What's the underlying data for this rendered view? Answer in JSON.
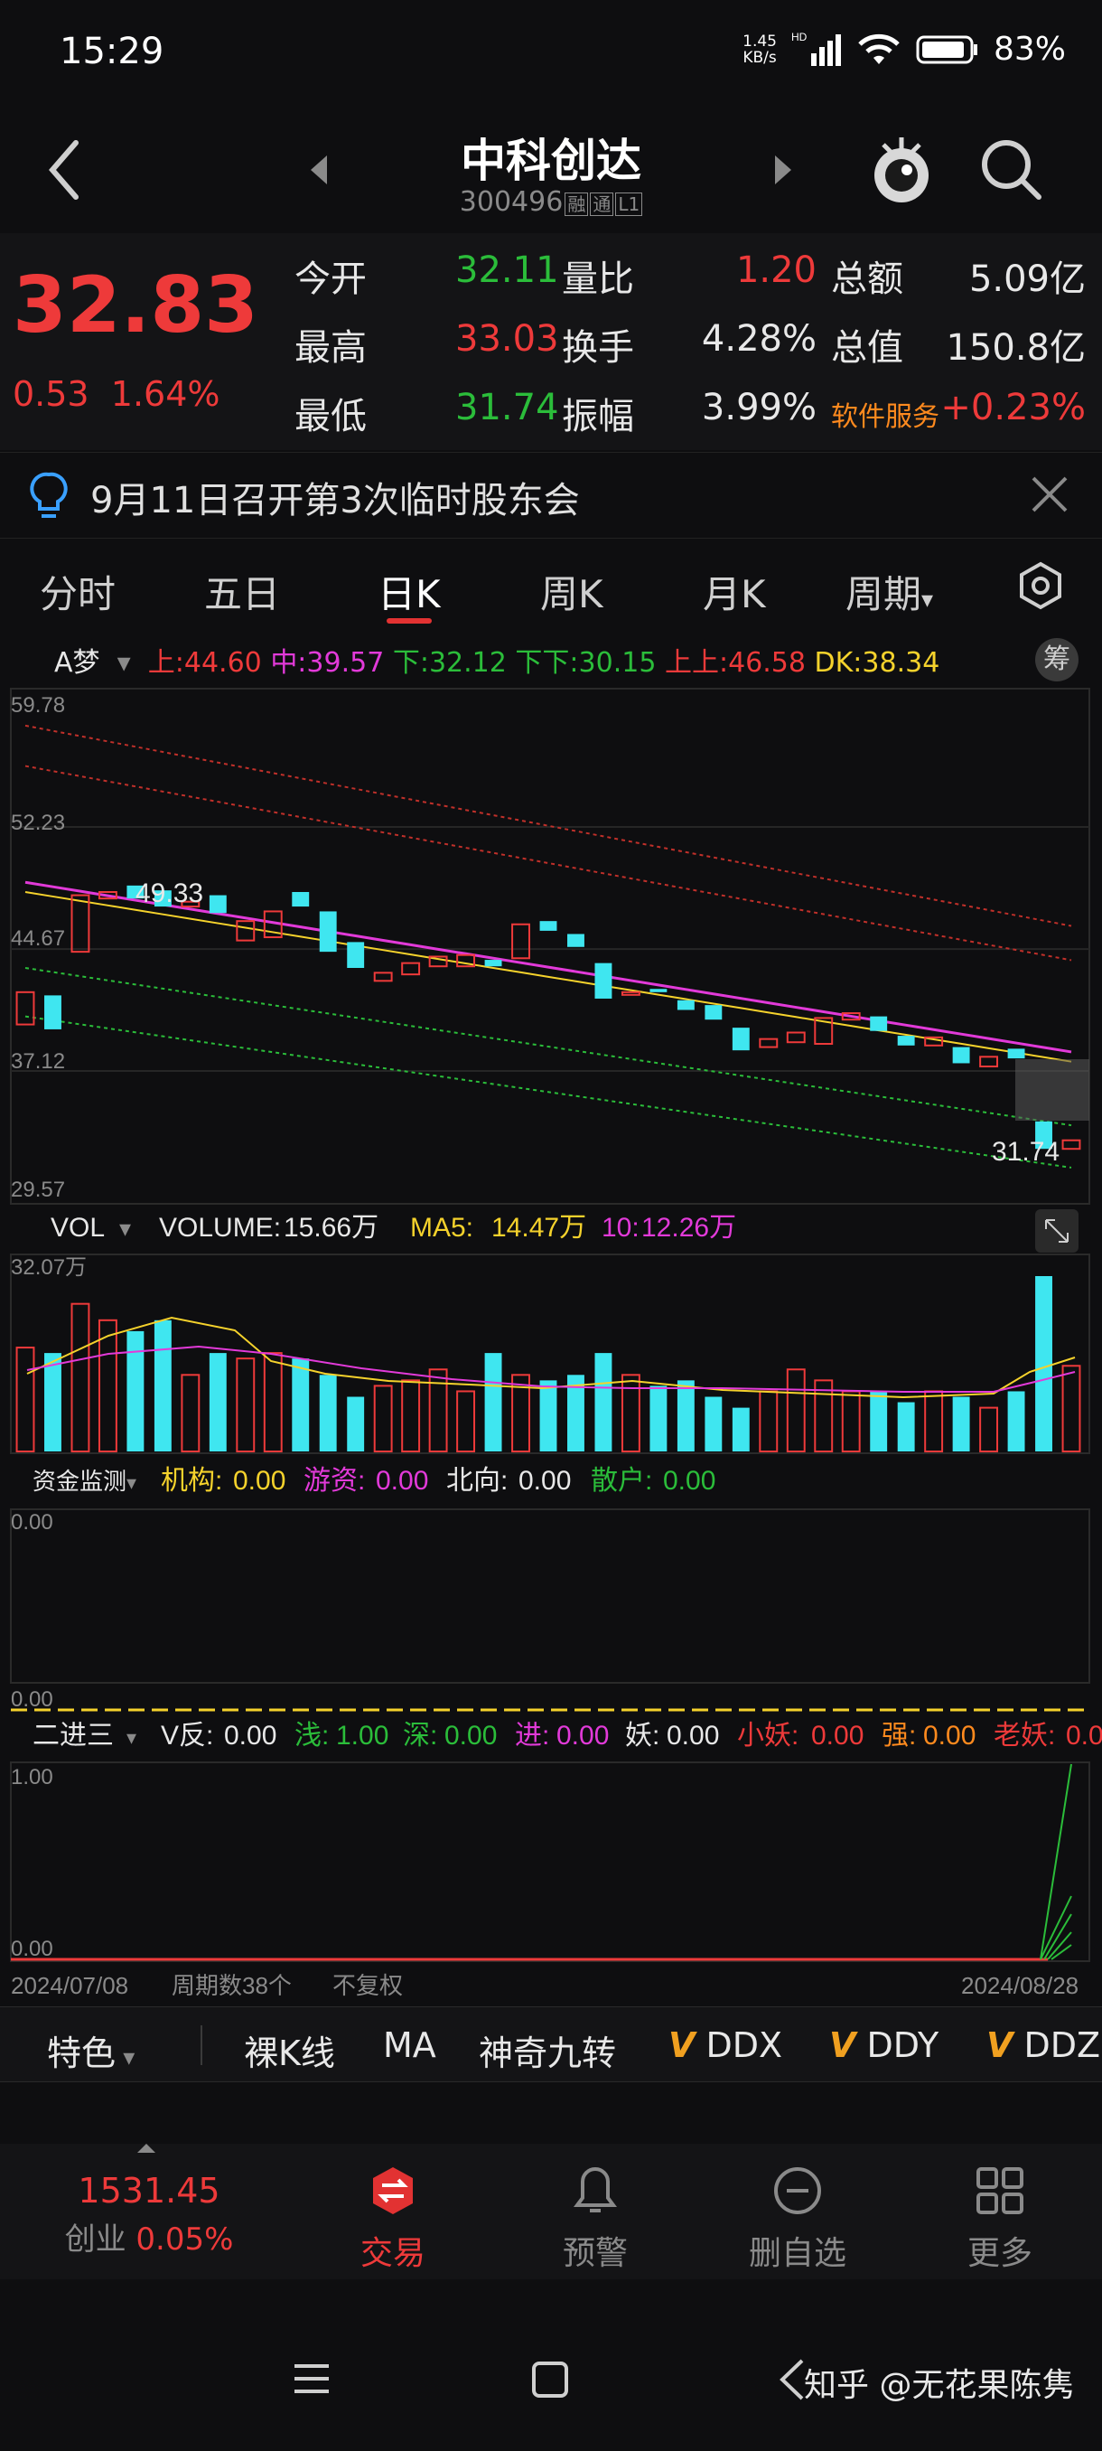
{
  "status_bar": {
    "time": "15:29",
    "net_speed_value": "1.45",
    "net_speed_unit": "KB/s",
    "hd": "HD",
    "battery": "83%"
  },
  "header": {
    "title": "中科创达",
    "code": "300496",
    "tag1": "融",
    "tag2": "通",
    "tag3": "L1"
  },
  "quote": {
    "price": "32.83",
    "change": "0.53",
    "change_pct": "1.64%",
    "open_label": "今开",
    "open": "32.11",
    "high_label": "最高",
    "high": "33.03",
    "low_label": "最低",
    "low": "31.74",
    "vol_ratio_label": "量比",
    "vol_ratio": "1.20",
    "turnover_label": "换手",
    "turnover": "4.28%",
    "amplitude_label": "振幅",
    "amplitude": "3.99%",
    "amount_label": "总额",
    "amount": "5.09亿",
    "mktcap_label": "总值",
    "mktcap": "150.8亿",
    "sector_label": "软件服务",
    "sector_change": "+0.23%"
  },
  "notice": {
    "text": "9月11日召开第3次临时股东会"
  },
  "tabs": [
    "分时",
    "五日",
    "日K",
    "周K",
    "月K",
    "周期"
  ],
  "kline": {
    "indicator_name": "A梦",
    "up_label": "上:",
    "up": "44.60",
    "mid_label": "中:",
    "mid": "39.57",
    "down_label": "下:",
    "down": "32.12",
    "downdown_label": "下下:",
    "downdown": "30.15",
    "upup_label": "上上:",
    "upup": "46.58",
    "dk_label": "DK:",
    "dk": "38.34",
    "chip_button": "筹",
    "y_labels": [
      "59.78",
      "52.23",
      "44.67",
      "37.12",
      "29.57"
    ],
    "high_annotation": "49.33",
    "low_annotation": "31.74"
  },
  "volume": {
    "name": "VOL",
    "volume_label": "VOLUME:",
    "volume": "15.66万",
    "ma5_label": "MA5:",
    "ma5": "14.47万",
    "ma10_label": "10:",
    "ma10": "12.26万",
    "max_label": "32.07万"
  },
  "capital": {
    "name": "资金监测",
    "inst_label": "机构:",
    "inst": "0.00",
    "hot_label": "游资:",
    "hot": "0.00",
    "north_label": "北向:",
    "north": "0.00",
    "retail_label": "散户:",
    "retail": "0.00",
    "top_label": "0.00",
    "bottom_label": "0.00"
  },
  "signal": {
    "name": "二进三",
    "v_label": "V反:",
    "v": "0.00",
    "shallow_label": "浅:",
    "shallow": "1.00",
    "deep_label": "深:",
    "deep": "0.00",
    "enter_label": "进:",
    "enter": "0.00",
    "demon_label": "妖:",
    "demon": "0.00",
    "small_label": "小妖:",
    "small": "0.00",
    "strong_label": "强:",
    "strong": "0.00",
    "old_label": "老妖:",
    "old": "0.0",
    "top_label": "1.00",
    "bottom_label": "0.00"
  },
  "footer_axis": {
    "start_date": "2024/07/08",
    "periods": "周期数38个",
    "adjust": "不复权",
    "end_date": "2024/08/28"
  },
  "features": {
    "special": "特色",
    "items": [
      "裸K线",
      "MA",
      "神奇九转",
      "DDX",
      "DDY",
      "DDZ"
    ],
    "v": "V"
  },
  "bottom_nav": {
    "index_value": "1531.45",
    "index_name": "创业",
    "index_change": "0.05%",
    "trade": "交易",
    "alert": "预警",
    "delete_watch": "删自选",
    "more": "更多"
  },
  "watermark": "知乎 @无花果陈隽",
  "chart_data": {
    "type": "candlestick",
    "candles": [
      {
        "o": 40.0,
        "c": 42.0
      },
      {
        "o": 41.8,
        "c": 39.7
      },
      {
        "o": 44.5,
        "c": 48.0
      },
      {
        "o": 47.8,
        "c": 48.2
      },
      {
        "o": 48.6,
        "c": 47.8
      },
      {
        "o": 48.3,
        "c": 47.3
      },
      {
        "o": 47.3,
        "c": 47.6
      },
      {
        "o": 48.0,
        "c": 46.9
      },
      {
        "o": 45.2,
        "c": 46.4
      },
      {
        "o": 45.4,
        "c": 47.0
      },
      {
        "o": 48.2,
        "c": 47.3
      },
      {
        "o": 47.0,
        "c": 44.5
      },
      {
        "o": 45.1,
        "c": 43.5
      },
      {
        "o": 42.7,
        "c": 43.2
      },
      {
        "o": 43.1,
        "c": 43.8
      },
      {
        "o": 43.6,
        "c": 44.2
      },
      {
        "o": 43.6,
        "c": 44.3
      },
      {
        "o": 44.0,
        "c": 43.6
      },
      {
        "o": 44.1,
        "c": 46.2
      },
      {
        "o": 46.4,
        "c": 45.8
      },
      {
        "o": 45.6,
        "c": 44.8
      },
      {
        "o": 43.8,
        "c": 41.6
      },
      {
        "o": 42.0,
        "c": 42.0
      },
      {
        "o": 42.2,
        "c": 42.0
      },
      {
        "o": 41.5,
        "c": 40.9
      },
      {
        "o": 41.2,
        "c": 40.3
      },
      {
        "o": 39.8,
        "c": 38.4
      },
      {
        "o": 38.6,
        "c": 39.1
      },
      {
        "o": 38.9,
        "c": 39.5
      },
      {
        "o": 38.8,
        "c": 40.4
      },
      {
        "o": 40.3,
        "c": 40.7
      },
      {
        "o": 40.5,
        "c": 39.6
      },
      {
        "o": 39.3,
        "c": 38.7
      },
      {
        "o": 38.7,
        "c": 39.2
      },
      {
        "o": 38.6,
        "c": 37.6
      },
      {
        "o": 37.4,
        "c": 38.0
      },
      {
        "o": 38.5,
        "c": 37.9
      },
      {
        "o": 34.0,
        "c": 32.3
      },
      {
        "o": 32.3,
        "c": 32.83
      }
    ],
    "volumes": [
      19,
      18,
      27,
      24,
      22,
      24,
      14,
      18,
      17,
      18,
      17,
      14,
      10,
      12,
      13,
      15,
      11,
      18,
      14,
      13,
      14,
      18,
      14,
      12,
      13,
      10,
      8,
      11,
      15,
      13,
      11,
      11,
      9,
      11,
      10,
      8,
      11,
      32.07,
      15.66
    ],
    "ylim": [
      29.57,
      59.78
    ],
    "vol_max": 32.07
  }
}
